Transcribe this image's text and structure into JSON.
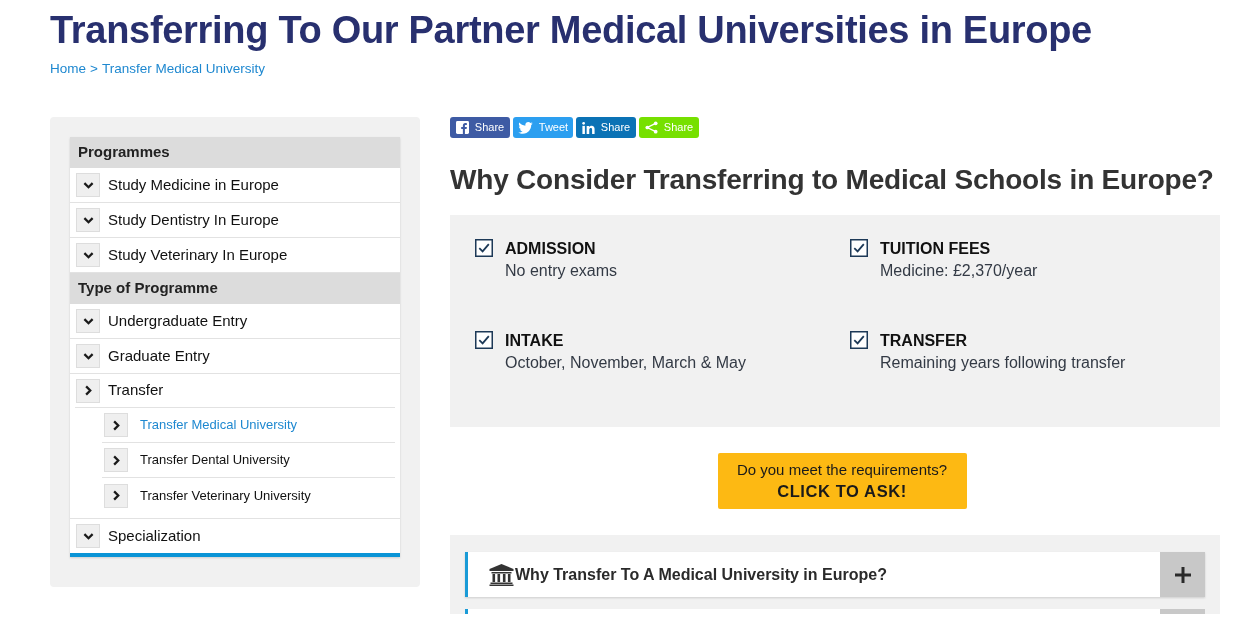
{
  "page_title": "Transferring To Our Partner Medical Universities in Europe",
  "breadcrumb": {
    "items": [
      "Home",
      "Transfer Medical University"
    ],
    "separator": ">"
  },
  "sidebar": {
    "sections": [
      {
        "heading": "Programmes",
        "items": [
          {
            "label": "Study Medicine in Europe",
            "kind": "dropdown",
            "selected": false
          },
          {
            "label": "Study Dentistry In Europe",
            "kind": "dropdown",
            "selected": false
          },
          {
            "label": "Study Veterinary In Europe",
            "kind": "dropdown",
            "selected": false
          }
        ]
      },
      {
        "heading": "Type of Programme",
        "items": [
          {
            "label": "Undergraduate Entry",
            "kind": "dropdown",
            "selected": false
          },
          {
            "label": "Graduate Entry",
            "kind": "dropdown",
            "selected": false
          },
          {
            "label": "Transfer",
            "kind": "link",
            "selected": false,
            "children": [
              {
                "label": "Transfer Medical University",
                "kind": "link",
                "selected": true
              },
              {
                "label": "Transfer Dental University",
                "kind": "link",
                "selected": false
              },
              {
                "label": "Transfer Veterinary University",
                "kind": "link",
                "selected": false
              }
            ]
          },
          {
            "label": "Specialization",
            "kind": "dropdown",
            "selected": false
          }
        ]
      }
    ]
  },
  "share_buttons": [
    {
      "kind": "facebook",
      "label": "Share"
    },
    {
      "kind": "twitter",
      "label": "Tweet"
    },
    {
      "kind": "linkedin",
      "label": "Share"
    },
    {
      "kind": "share",
      "label": "Share"
    }
  ],
  "features": {
    "heading": "Why Consider Transferring to Medical Schools in Europe?",
    "items": [
      {
        "title": "ADMISSION",
        "text": "No entry exams",
        "checked": true
      },
      {
        "title": "TUITION FEES",
        "text": "Medicine: £2,370/year",
        "checked": true
      },
      {
        "title": "INTAKE",
        "text": "October, November, March & May",
        "checked": true
      },
      {
        "title": "TRANSFER",
        "text": "Remaining years following transfer",
        "checked": true
      }
    ]
  },
  "cta": {
    "line_1": "Do you meet the requirements?",
    "line_2": "CLICK TO ASK!"
  },
  "accordion": {
    "items": [
      {
        "title": "Why Transfer To A Medical University in Europe?",
        "expanded": false
      }
    ]
  }
}
